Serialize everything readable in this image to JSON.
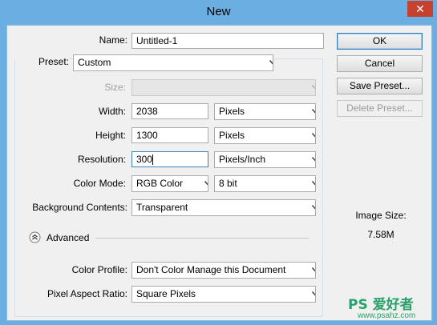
{
  "window": {
    "title": "New",
    "close_glyph": "✕"
  },
  "name": {
    "label": "Name:",
    "value": "Untitled-1"
  },
  "preset": {
    "label": "Preset:",
    "value": "Custom"
  },
  "size": {
    "label": "Size:",
    "value": ""
  },
  "width": {
    "label": "Width:",
    "value": "2038",
    "unit": "Pixels"
  },
  "height": {
    "label": "Height:",
    "value": "1300",
    "unit": "Pixels"
  },
  "resolution": {
    "label": "Resolution:",
    "value": "300",
    "unit": "Pixels/Inch"
  },
  "color_mode": {
    "label": "Color Mode:",
    "value": "RGB Color",
    "depth": "8 bit"
  },
  "background": {
    "label": "Background Contents:",
    "value": "Transparent"
  },
  "advanced": {
    "label": "Advanced"
  },
  "color_profile": {
    "label": "Color Profile:",
    "value": "Don't Color Manage this Document"
  },
  "pixel_aspect": {
    "label": "Pixel Aspect Ratio:",
    "value": "Square Pixels"
  },
  "buttons": {
    "ok": "OK",
    "cancel": "Cancel",
    "save_preset": "Save Preset...",
    "delete_preset": "Delete Preset..."
  },
  "image_size": {
    "label": "Image Size:",
    "value": "7.58M"
  },
  "watermark": {
    "text": "PS 爱好者",
    "url": "www.psahz.com"
  },
  "colors": {
    "accent": "#3c7fb1",
    "titlebar": "#6aaee2",
    "close": "#c7412f"
  }
}
